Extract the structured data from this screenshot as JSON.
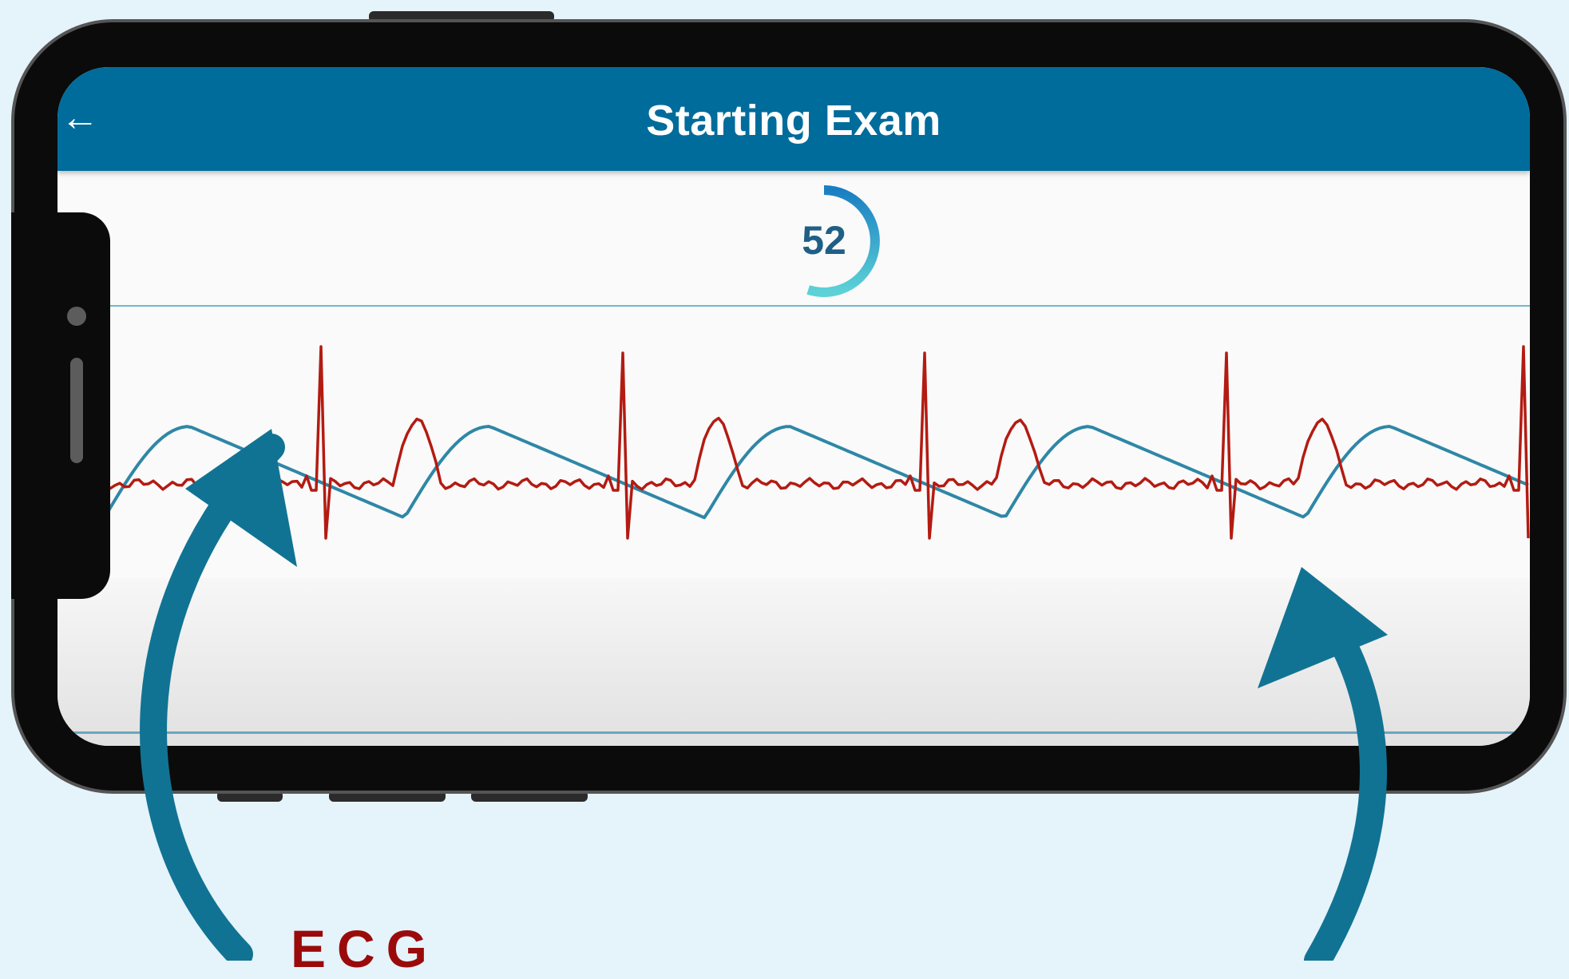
{
  "app": {
    "title": "Starting Exam",
    "back_icon": "arrow-left-icon"
  },
  "timer": {
    "value": "52",
    "progress": 0.55
  },
  "annotations": {
    "ecg_label": "ECG"
  },
  "colors": {
    "app_bar": "#006c9b",
    "ecg_trace": "#b31b12",
    "pulse_trace": "#2f87a6",
    "annotation_arrow": "#117393",
    "ecg_label": "#9b0a0a",
    "background": "#e5f3fa"
  }
}
